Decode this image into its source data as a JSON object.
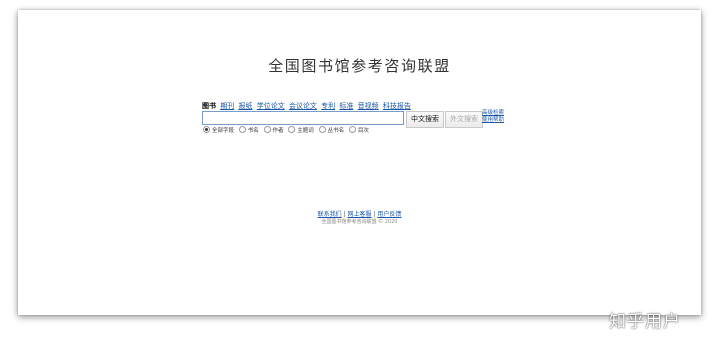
{
  "site_title": "全国图书馆参考咨询联盟",
  "type_tabs": [
    {
      "label": "图书",
      "active": true
    },
    {
      "label": "期刊",
      "active": false
    },
    {
      "label": "报纸",
      "active": false
    },
    {
      "label": "学位论文",
      "active": false
    },
    {
      "label": "会议论文",
      "active": false
    },
    {
      "label": "专利",
      "active": false
    },
    {
      "label": "标准",
      "active": false
    },
    {
      "label": "音视频",
      "active": false
    },
    {
      "label": "科技报告",
      "active": false
    }
  ],
  "search": {
    "value": "",
    "zh_button": "中文搜索",
    "foreign_button": "外文搜索"
  },
  "side_links": {
    "advanced": "高级检索",
    "help": "使用帮助"
  },
  "field_options": [
    {
      "label": "全部字段",
      "selected": true
    },
    {
      "label": "书名",
      "selected": false
    },
    {
      "label": "作者",
      "selected": false
    },
    {
      "label": "主题词",
      "selected": false
    },
    {
      "label": "丛书名",
      "selected": false
    },
    {
      "label": "目次",
      "selected": false
    }
  ],
  "footer": {
    "contact": "联系我们",
    "sep": "|",
    "reader_guide": "网上客服",
    "feedback": "用户反馈",
    "copyright": "全国图书馆参考咨询联盟 © 2020"
  },
  "watermark": "知乎用户",
  "colors": {
    "link": "#1a57a8",
    "input_border": "#7a9cc8"
  }
}
